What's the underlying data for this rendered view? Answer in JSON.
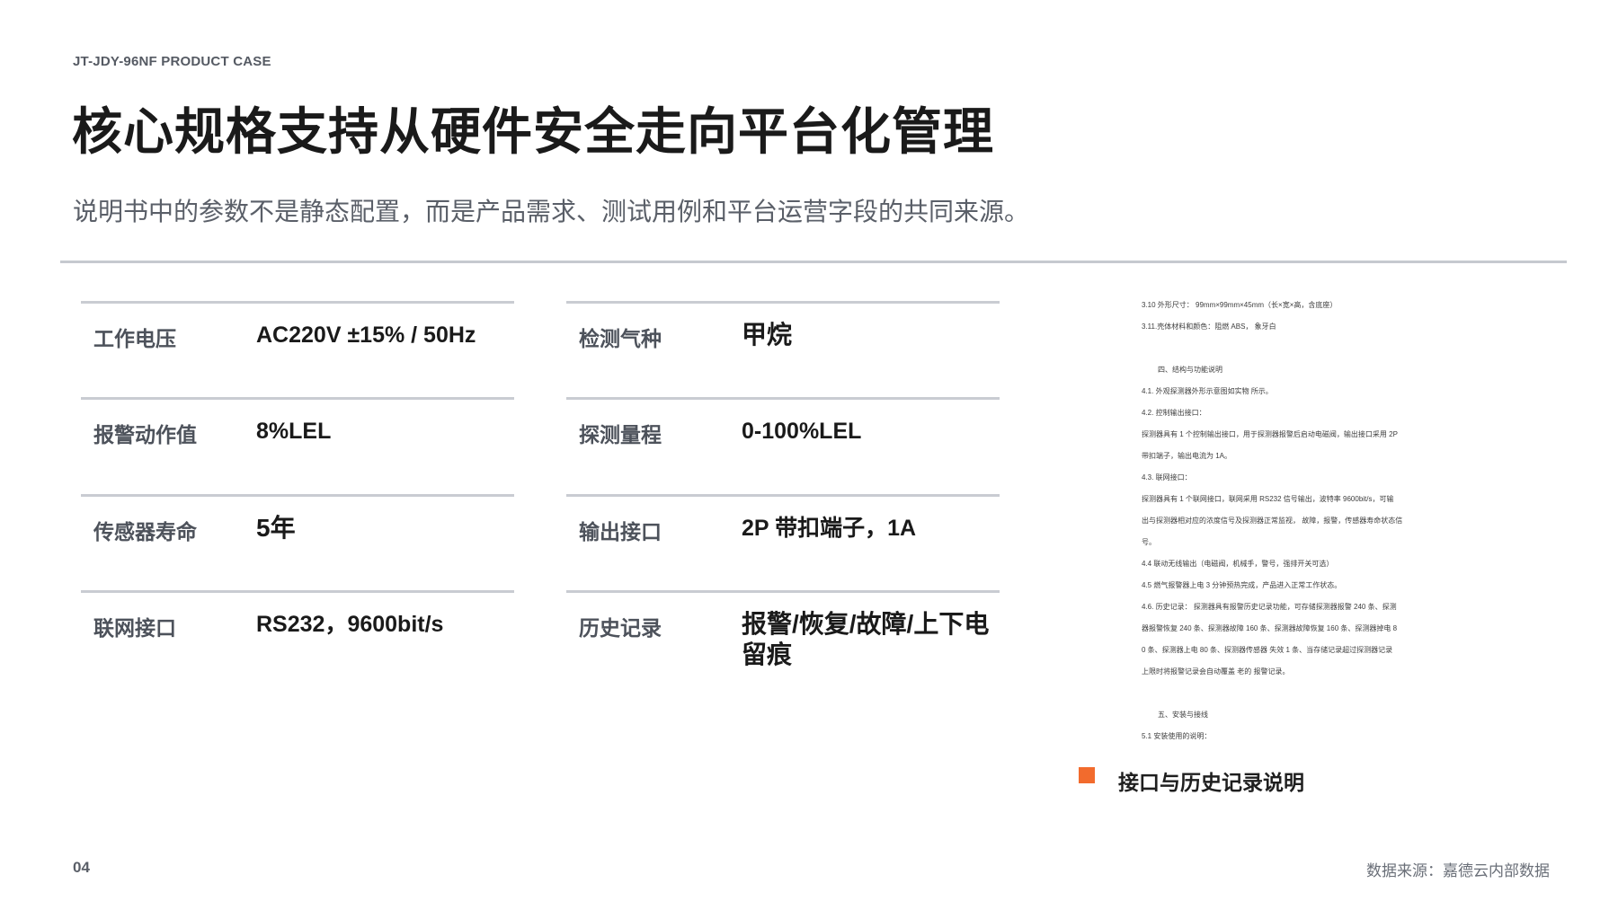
{
  "header": {
    "eyebrow": "JT-JDY-96NF PRODUCT CASE",
    "title": "核心规格支持从硬件安全走向平台化管理",
    "subtitle": "说明书中的参数不是静态配置，而是产品需求、测试用例和平台运营字段的共同来源。"
  },
  "specs": {
    "left": [
      {
        "label": "工作电压",
        "value": "AC220V ±15% / 50Hz"
      },
      {
        "label": "报警动作值",
        "value": "8%LEL"
      },
      {
        "label": "传感器寿命",
        "value": "5年"
      },
      {
        "label": "联网接口",
        "value": "RS232，9600bit/s"
      }
    ],
    "right": [
      {
        "label": "检测气种",
        "value": "甲烷"
      },
      {
        "label": "探测量程",
        "value": "0-100%LEL"
      },
      {
        "label": "输出接口",
        "value": "2P 带扣端子，1A"
      },
      {
        "label": "历史记录",
        "value": "报警/恢复/故障/上下电留痕"
      }
    ]
  },
  "document_excerpt": {
    "lines": [
      "3.10 外形尺寸： 99mm×99mm×45mm（长×宽×高，含底座）",
      "3.11.壳体材料和颜色：阻燃 ABS， 象牙白",
      "四、结构与功能说明",
      "4.1. 外观探测器外形示意图如实物 所示。",
      "4.2. 控制输出接口：",
      "探测器具有 1 个控制输出接口，用于探测器报警后启动电磁阀，输出接口采用 2P",
      "带扣端子，输出电流为 1A。",
      "4.3. 联网接口：",
      "探测器具有 1 个联网接口，联网采用 RS232 信号输出，波特率 9600bit/s，可输",
      "出与探测器相对应的浓度信号及探测器正常监视， 故障，报警，传感器寿命状态信",
      "号。",
      "4.4 联动无线输出（电磁阀，机械手，警号，强排开关可选）",
      "4.5 燃气报警器上电 3 分钟预热完成，产品进入正常工作状态。",
      "4.6. 历史记录： 探测器具有报警历史记录功能，可存储探测器报警 240 条、探测",
      "器报警恢复 240 条、探测器故障 160 条、探测器故障恢复 160 条、探测器掉电 8",
      "0 条、探测器上电 80 条、探测器传感器 失效 1 条、当存储记录超过探测器记录",
      "上限时将报警记录会自动覆盖 老的 报警记录。",
      "五、安装与接线",
      "5.1 安装使用的说明："
    ]
  },
  "caption": {
    "text": "接口与历史记录说明",
    "accent_color": "#f26b2d"
  },
  "footer": {
    "page_number": "04",
    "source": "数据来源：嘉德云内部数据"
  }
}
